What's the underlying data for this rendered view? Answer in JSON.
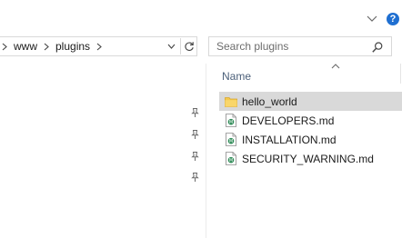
{
  "help": {
    "label": "?"
  },
  "address": {
    "crumbs": [
      "www",
      "plugins"
    ]
  },
  "search": {
    "placeholder": "Search plugins"
  },
  "columns": {
    "name": "Name"
  },
  "files": [
    {
      "name": "hello_world",
      "kind": "folder",
      "selected": true
    },
    {
      "name": "DEVELOPERS.md",
      "kind": "markdown",
      "selected": false
    },
    {
      "name": "INSTALLATION.md",
      "kind": "markdown",
      "selected": false
    },
    {
      "name": "SECURITY_WARNING.md",
      "kind": "markdown",
      "selected": false
    }
  ],
  "icons": {
    "ribbon_toggle": "chevron-down-icon",
    "help": "help-icon",
    "refresh": "refresh-icon",
    "search": "search-icon",
    "pin": "pin-icon",
    "folder": "folder-icon",
    "markdown": "markdown-file-icon"
  },
  "colors": {
    "help_blue": "#1f6fd1",
    "selection": "#d9d9d9",
    "folder_yellow": "#f4c84e",
    "file_icon_green": "#2e8b57"
  }
}
